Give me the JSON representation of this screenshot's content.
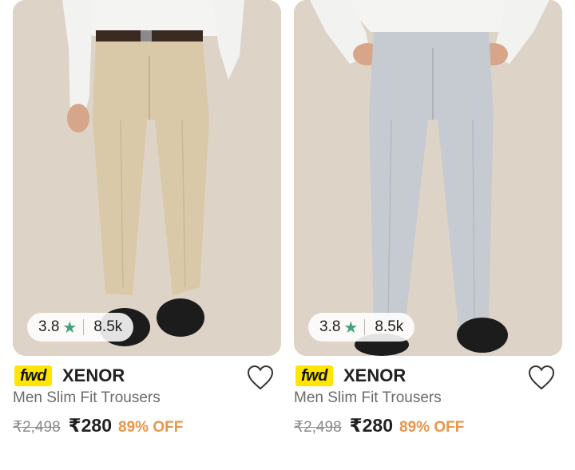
{
  "products": [
    {
      "rating": "3.8",
      "rating_count": "8.5k",
      "badge": "fwd",
      "brand": "XENOR",
      "title": "Men Slim Fit Trousers",
      "mrp": "₹2,498",
      "price": "₹280",
      "discount": "89% OFF",
      "pant_color": "#d9c9a8",
      "icons": [
        "star-icon",
        "heart-icon"
      ]
    },
    {
      "rating": "3.8",
      "rating_count": "8.5k",
      "badge": "fwd",
      "brand": "XENOR",
      "title": "Men Slim Fit Trousers",
      "mrp": "₹2,498",
      "price": "₹280",
      "discount": "89% OFF",
      "pant_color": "#c6cbd1",
      "icons": [
        "star-icon",
        "heart-icon"
      ]
    }
  ],
  "colors": {
    "rating_star": "#3fa37d",
    "fwd_badge": "#ffe500",
    "discount": "#e8964a",
    "background_photo": "#ddd3c7"
  }
}
